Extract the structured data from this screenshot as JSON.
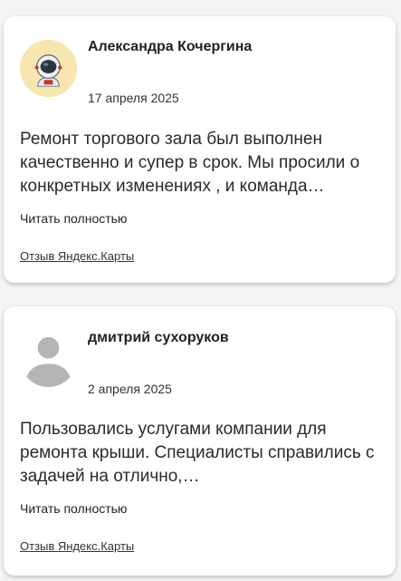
{
  "reviews": [
    {
      "author": "Александра Кочергина",
      "date": "17 апреля 2025",
      "text": "Ремонт торгового зала был выполнен качественно и супер в срок. Мы просили о конкретных изменениях , и команда…",
      "read_more": "Читать полностью",
      "source": "Отзыв Яндекс.Карты",
      "avatar_icon": "astronaut-avatar-icon",
      "avatar_bg": "#f8e6b0"
    },
    {
      "author": "дмитрий сухоруков",
      "date": "2 апреля 2025",
      "text": "Пользовались услугами компании для ремонта крыши. Специалисты справились с задачей на отлично,…",
      "read_more": "Читать полностью",
      "source": "Отзыв Яндекс.Карты",
      "avatar_icon": "default-user-avatar-icon",
      "avatar_bg": "#ffffff"
    }
  ]
}
